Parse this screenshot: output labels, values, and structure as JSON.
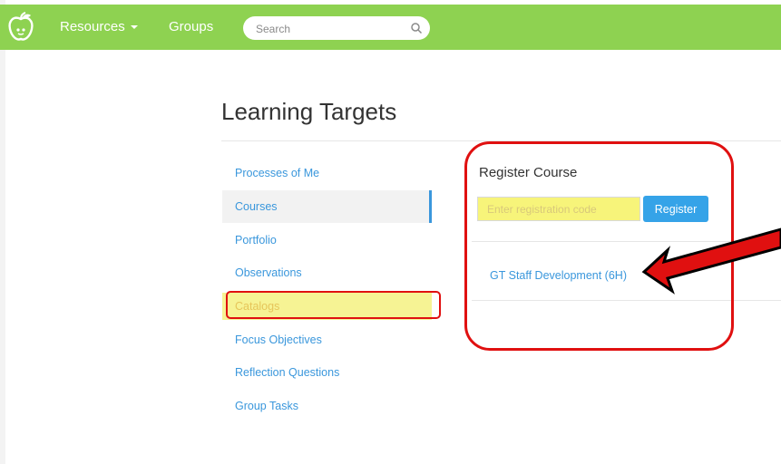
{
  "nav": {
    "resources_label": "Resources",
    "groups_label": "Groups",
    "search_placeholder": "Search"
  },
  "page": {
    "title": "Learning Targets"
  },
  "sidebar": {
    "items": [
      {
        "label": "Processes of Me"
      },
      {
        "label": "Courses"
      },
      {
        "label": "Portfolio"
      },
      {
        "label": "Observations"
      },
      {
        "label": "Catalogs"
      },
      {
        "label": "Focus Objectives"
      },
      {
        "label": "Reflection Questions"
      },
      {
        "label": "Group Tasks"
      }
    ]
  },
  "register": {
    "title": "Register Course",
    "input_placeholder": "Enter registration code",
    "button_label": "Register",
    "courses": [
      {
        "label": "GT Staff Development (6H)"
      }
    ]
  },
  "colors": {
    "navbar": "#8ed251",
    "link": "#3a97dc",
    "button": "#35a3e8",
    "highlight": "#f6f394",
    "annotation": "#e01010"
  }
}
